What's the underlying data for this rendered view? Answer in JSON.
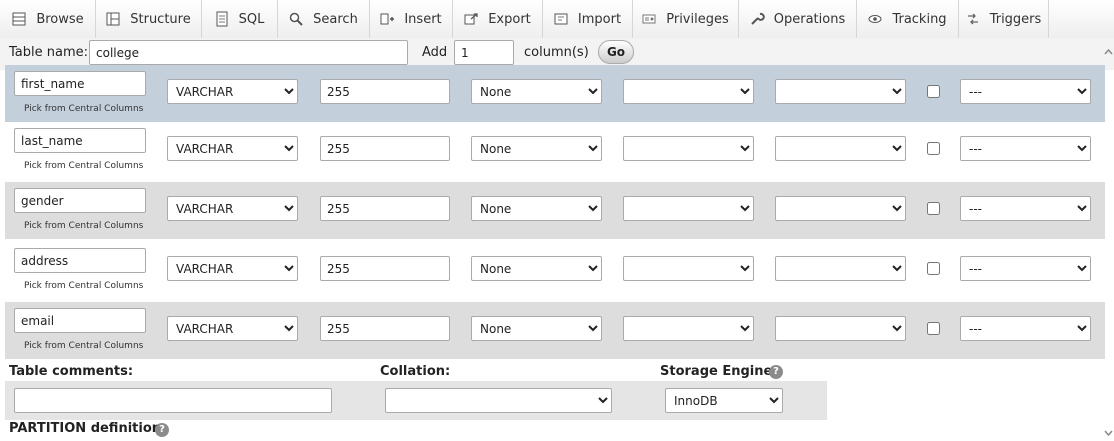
{
  "tabs": [
    {
      "label": "Browse",
      "icon": "browse-icon"
    },
    {
      "label": "Structure",
      "icon": "structure-icon"
    },
    {
      "label": "SQL",
      "icon": "sql-icon"
    },
    {
      "label": "Search",
      "icon": "search-icon"
    },
    {
      "label": "Insert",
      "icon": "insert-icon"
    },
    {
      "label": "Export",
      "icon": "export-icon"
    },
    {
      "label": "Import",
      "icon": "import-icon"
    },
    {
      "label": "Privileges",
      "icon": "privileges-icon"
    },
    {
      "label": "Operations",
      "icon": "operations-icon"
    },
    {
      "label": "Tracking",
      "icon": "tracking-icon"
    },
    {
      "label": "Triggers",
      "icon": "triggers-icon"
    }
  ],
  "table_name": {
    "label": "Table name:",
    "value": "college"
  },
  "add_columns": {
    "add_label": "Add",
    "count": "1",
    "suffix": "column(s)",
    "go": "Go"
  },
  "columns": [
    {
      "name": "first_name",
      "type": "VARCHAR",
      "length": "255",
      "default": "None",
      "collation": "",
      "attributes": "",
      "null": false,
      "index": "---",
      "pick": "Pick from Central Columns"
    },
    {
      "name": "last_name",
      "type": "VARCHAR",
      "length": "255",
      "default": "None",
      "collation": "",
      "attributes": "",
      "null": false,
      "index": "---",
      "pick": "Pick from Central Columns"
    },
    {
      "name": "gender",
      "type": "VARCHAR",
      "length": "255",
      "default": "None",
      "collation": "",
      "attributes": "",
      "null": false,
      "index": "---",
      "pick": "Pick from Central Columns"
    },
    {
      "name": "address",
      "type": "VARCHAR",
      "length": "255",
      "default": "None",
      "collation": "",
      "attributes": "",
      "null": false,
      "index": "---",
      "pick": "Pick from Central Columns"
    },
    {
      "name": "email",
      "type": "VARCHAR",
      "length": "255",
      "default": "None",
      "collation": "",
      "attributes": "",
      "null": false,
      "index": "---",
      "pick": "Pick from Central Columns"
    }
  ],
  "footer": {
    "comments_label": "Table comments:",
    "comments_value": "",
    "collation_label": "Collation:",
    "collation_value": "",
    "engine_label": "Storage Engine:",
    "engine_value": "InnoDB",
    "partition_label": "PARTITION definition:",
    "help_icon": "help-icon"
  },
  "colors": {
    "tab_bar": "#eeeeee",
    "row_highlight": "#c4cfdc",
    "row_shaded": "#dddddd",
    "row_plain": "#ffffff"
  }
}
